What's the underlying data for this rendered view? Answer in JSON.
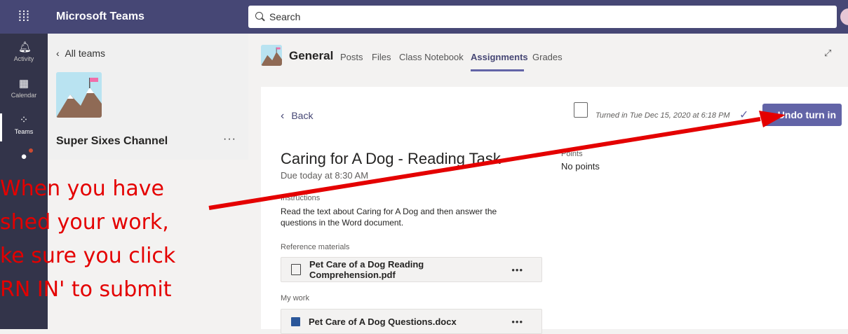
{
  "app": {
    "name": "Microsoft Teams"
  },
  "search": {
    "placeholder": "Search"
  },
  "rail": [
    {
      "label": "Activity",
      "icon": "bell-icon"
    },
    {
      "label": "Calendar",
      "icon": "calendar-icon"
    },
    {
      "label": "Teams",
      "icon": "teams-icon"
    }
  ],
  "team": {
    "back_label": "All teams",
    "channel_name": "Super Sixes Channel",
    "more": "···"
  },
  "header": {
    "channel": "General",
    "tabs": [
      "Posts",
      "Files",
      "Class Notebook",
      "Assignments",
      "Grades"
    ],
    "active_tab": "Assignments"
  },
  "assignment": {
    "back_label": "Back",
    "turned_in": "Turned in Tue Dec 15, 2020 at 6:18 PM",
    "undo_button": "Undo turn in",
    "title": "Caring for A Dog - Reading Task",
    "due": "Due today at 8:30 AM",
    "points_label": "Points",
    "points_value": "No points",
    "instructions_label": "Instructions",
    "instructions": "Read the text about Caring for A Dog and then answer the questions in the Word document.",
    "reference_label": "Reference materials",
    "reference_file": "Pet Care of a Dog Reading Comprehension.pdf",
    "mywork_label": "My work",
    "mywork_file": "Pet Care of A Dog Questions.docx",
    "file_more": "•••"
  },
  "annotation": {
    "lines": [
      "When you have",
      "shed your work,",
      "ke sure you click",
      "RN IN' to submit"
    ],
    "color": "#e40000"
  },
  "colors": {
    "accent": "#6264a7",
    "topbar": "#464775",
    "rail": "#33344a"
  }
}
